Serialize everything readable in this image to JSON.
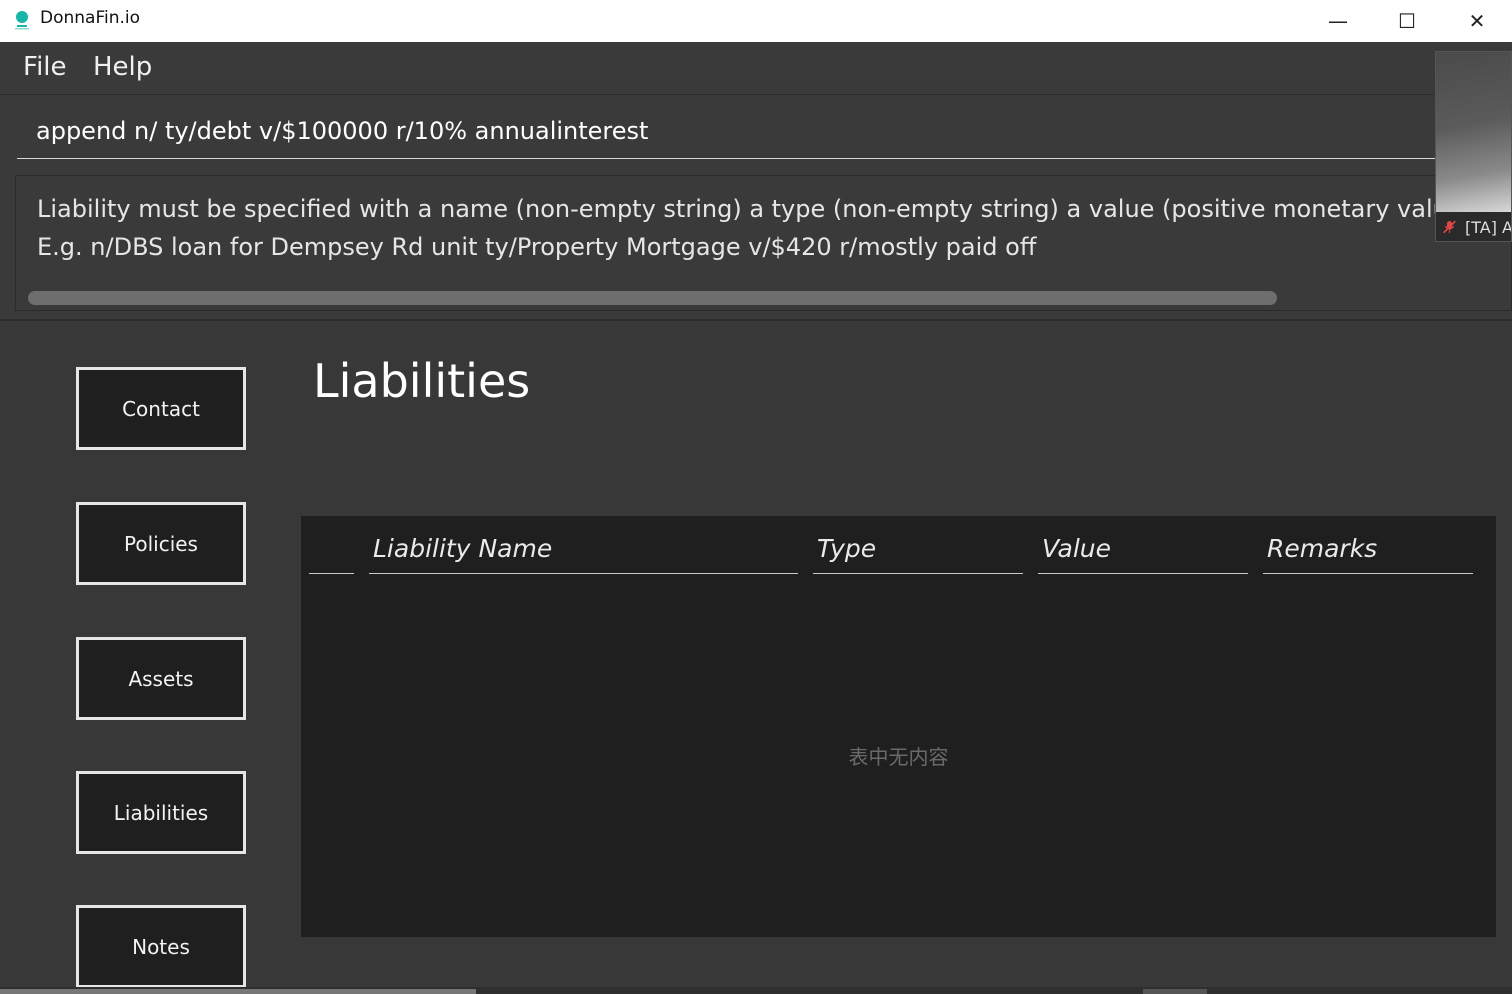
{
  "window": {
    "title": "DonnaFin.io",
    "min_glyph": "—",
    "max_glyph": "☐",
    "close_glyph": "✕",
    "accent_color": "#18b6a8"
  },
  "menu": {
    "file": "File",
    "help": "Help"
  },
  "command": {
    "value": "append n/ ty/debt v/$100000 r/10% annualinterest"
  },
  "result": {
    "line1": "Liability must be specified with a name (non-empty string) a type (non-empty string) a value (positive monetary value) a re",
    "line2": "E.g. n/DBS loan for Dempsey Rd unit ty/Property Mortgage v/$420 r/mostly paid off"
  },
  "nav": {
    "contact": "Contact",
    "policies": "Policies",
    "assets": "Assets",
    "liabilities": "Liabilities",
    "notes": "Notes"
  },
  "page": {
    "title": "Liabilities"
  },
  "table": {
    "columns": [
      "",
      "Liability Name",
      "Type",
      "Value",
      "Remarks"
    ],
    "rows": [],
    "empty_text": "表中无内容"
  },
  "video": {
    "label": "[TA] A",
    "mic_icon": "mic-muted-icon"
  }
}
